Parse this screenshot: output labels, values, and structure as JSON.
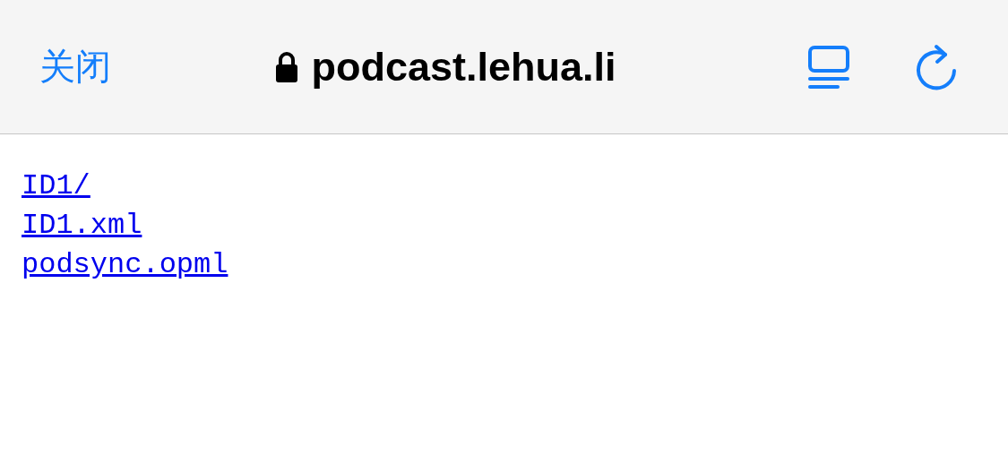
{
  "header": {
    "close_label": "关闭",
    "url": "podcast.lehua.li",
    "secure": true
  },
  "links": [
    {
      "label": "ID1/"
    },
    {
      "label": "ID1.xml"
    },
    {
      "label": "podsync.opml"
    }
  ]
}
